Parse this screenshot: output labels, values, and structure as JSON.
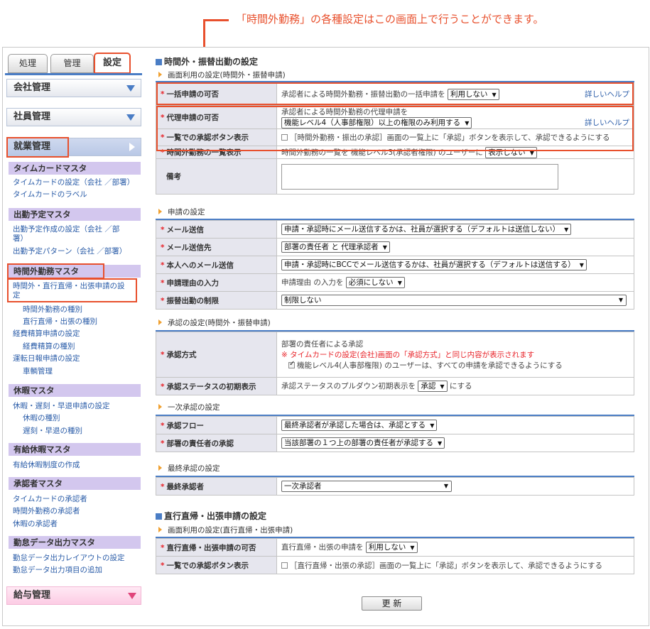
{
  "callout": "「時間外勤務」の各種設定はこの画面上で行うことができます。",
  "tabs": [
    "処理",
    "管理",
    "設定"
  ],
  "sidebar": {
    "sections": {
      "company": "会社管理",
      "employee": "社員管理",
      "work": "就業管理",
      "salary": "給与管理"
    },
    "categories": {
      "timecard": "タイムカードマスタ",
      "schedule": "出勤予定マスタ",
      "overtime": "時間外勤務マスタ",
      "vacation": "休暇マスタ",
      "paid": "有給休暇マスタ",
      "approver": "承認者マスタ",
      "export": "勤怠データ出力マスタ"
    },
    "links": {
      "tc1": "タイムカードの設定（会社 ／部署）",
      "tc2": "タイムカードのラベル",
      "sc1a": "出勤予定作成の設定（会社 ／部",
      "sc1b": "署）",
      "sc2": "出勤予定パターン（会社 ／部署）",
      "ot1a": "時間外・直行直帰・出張申請の設",
      "ot1b": "定",
      "ot2": "時間外勤務の種別",
      "ot3": "直行直帰・出張の種別",
      "ot4": "経費精算申請の設定",
      "ot5": "経費精算の種別",
      "ot6": "運転日報申請の設定",
      "ot7": "車輌管理",
      "va1": "休暇・遅刻・早退申請の設定",
      "va2": "休暇の種別",
      "va3": "遅刻・早退の種別",
      "pa1": "有給休暇制度の作成",
      "ap1": "タイムカードの承認者",
      "ap2": "時間外勤務の承認者",
      "ap3": "休暇の承認者",
      "ex1": "勤怠データ出力レイアウトの設定",
      "ex2": "勤怠データ出力項目の追加"
    }
  },
  "overtime": {
    "title": "時間外・振替出勤の設定",
    "usage": {
      "subtitle": "画面利用の設定(時間外・振替申請)",
      "bulk": {
        "label": "一括申請の可否",
        "text": "承認者による時間外勤務・振替出勤の一括申請を",
        "select": "利用しない",
        "help": "詳しいヘルプ"
      },
      "proxy": {
        "label": "代理申請の可否",
        "text": "承認者による時間外勤務の代理申請を",
        "select": "機能レベル4（人事部権限）以上の権限のみ利用する",
        "help": "詳しいヘルプ"
      },
      "list_approve": {
        "label": "一覧での承認ボタン表示",
        "text": "［時間外勤務・振出の承認］画面の一覧上に「承認」ボタンを表示して、承認できるようにする"
      },
      "list_show": {
        "label": "時間外勤務の一覧表示",
        "text": "時間外勤務の一覧を 機能レベル3(承認者権限) のユーザーに",
        "select": "表示しない"
      },
      "note": {
        "label": "備考"
      }
    },
    "request": {
      "subtitle": "申請の設定",
      "mail": {
        "label": "メール送信",
        "select": "申請・承認時にメール送信するかは、社員が選択する（デフォルトは送信しない）"
      },
      "mail_to": {
        "label": "メール送信先",
        "select": "部署の責任者 と 代理承認者"
      },
      "mail_self": {
        "label": "本人へのメール送信",
        "select": "申請・承認時にBCCでメール送信するかは、社員が選択する（デフォルトは送信する）"
      },
      "reason": {
        "label": "申請理由の入力",
        "text": "申請理由 の入力を",
        "select": "必須にしない"
      },
      "limit": {
        "label": "振替出勤の制限",
        "select": "制限しない"
      }
    },
    "approval": {
      "subtitle": "承認の設定(時間外・振替申請)",
      "method": {
        "label": "承認方式",
        "line1": "部署の責任者による承認",
        "line2": "※ タイムカードの設定(会社)画面の「承認方式」と同じ内容が表示されます",
        "line3": "機能レベル4(人事部権限) のユーザーは、すべての申請を承認できるようにする"
      },
      "status": {
        "label": "承認ステータスの初期表示",
        "text": "承認ステータスのプルダウン初期表示を",
        "select": "承認",
        "suffix": "にする"
      }
    },
    "first": {
      "subtitle": "一次承認の設定",
      "flow": {
        "label": "承認フロー",
        "select": "最終承認者が承認した場合は、承認とする"
      },
      "dept": {
        "label": "部署の責任者の承認",
        "select": "当該部署の１つ上の部署の責任者が承認する"
      }
    },
    "final": {
      "subtitle": "最終承認の設定",
      "approver": {
        "label": "最終承認者",
        "select": "一次承認者"
      }
    }
  },
  "direct": {
    "title": "直行直帰・出張申請の設定",
    "subtitle": "画面利用の設定(直行直帰・出張申請)",
    "usage": {
      "label": "直行直帰・出張申請の可否",
      "text": "直行直帰・出張の申請を",
      "select": "利用しない"
    },
    "list_approve": {
      "label": "一覧での承認ボタン表示",
      "text": "［直行直帰・出張の承認］画面の一覧上に「承認」ボタンを表示して、承認できるようにする"
    }
  },
  "update_button": "更 新",
  "colors": {
    "accent": "#e8502d",
    "brand_blue": "#4a7dc5",
    "category_purple": "#d3c7ee",
    "required_red": "#e8242a"
  }
}
